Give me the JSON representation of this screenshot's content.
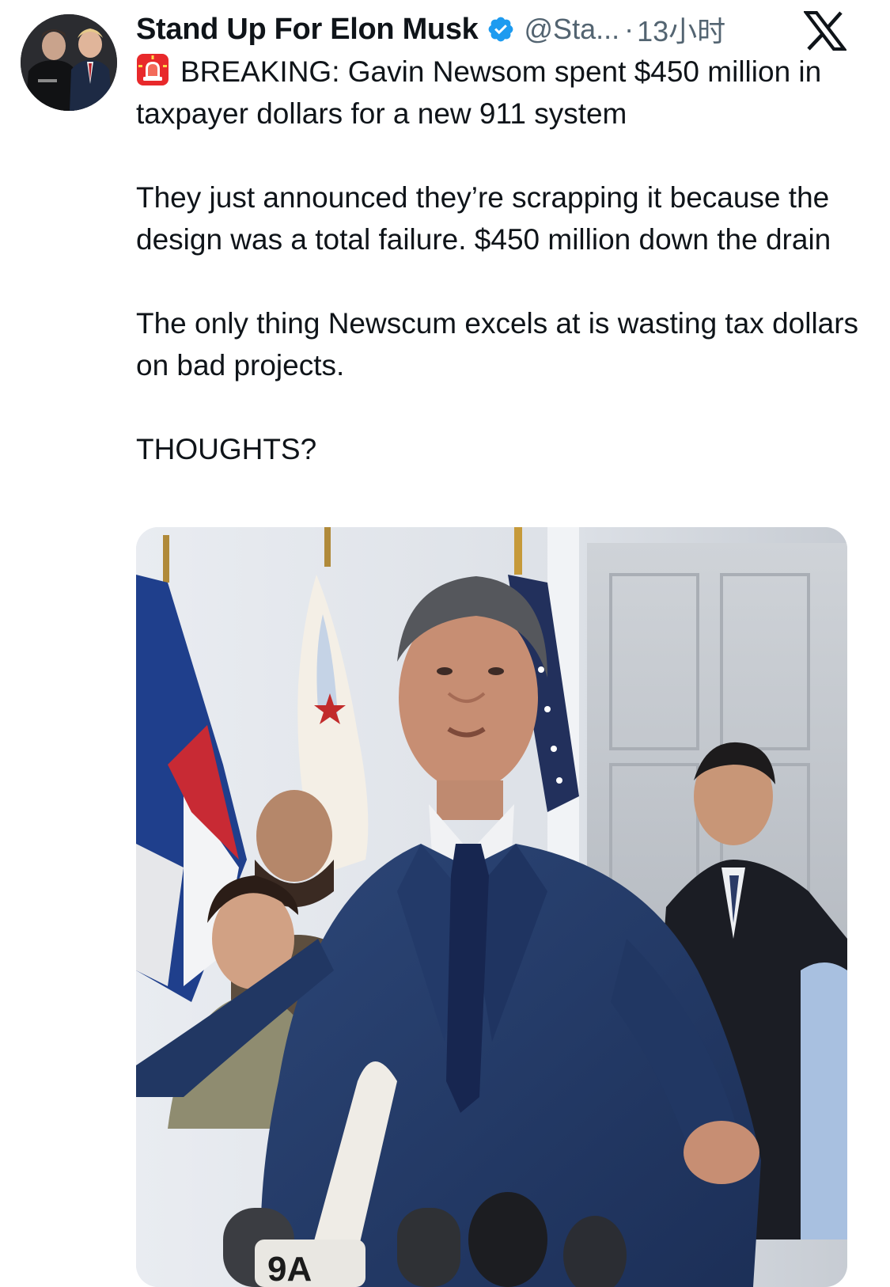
{
  "author": {
    "display_name": "Stand Up For Elon Musk",
    "handle": "@Sta...",
    "separator": "·",
    "timestamp": "13小时",
    "verified": true
  },
  "tweet": {
    "emoji": "siren-emoji",
    "paragraphs": [
      "BREAKING: Gavin Newsom spent $450 million in taxpayer dollars for a new 911 system",
      "They just announced they’re scrapping it because the design was a total failure. $450 million down the drain",
      "The only thing Newscum excels at is wasting tax dollars on bad projects.",
      "THOUGHTS?"
    ]
  },
  "media": {
    "alt": "Photo of Gavin Newsom speaking at a press podium in front of flags",
    "mic_labels": [
      "9A"
    ]
  },
  "icons": {
    "platform_logo": "x-logo-icon",
    "verified": "verified-badge-icon",
    "siren": "siren-emoji"
  },
  "colors": {
    "text_primary": "#0f1419",
    "text_secondary": "#536471",
    "verified_blue": "#1d9bf0",
    "suit_navy": "#22396b"
  }
}
